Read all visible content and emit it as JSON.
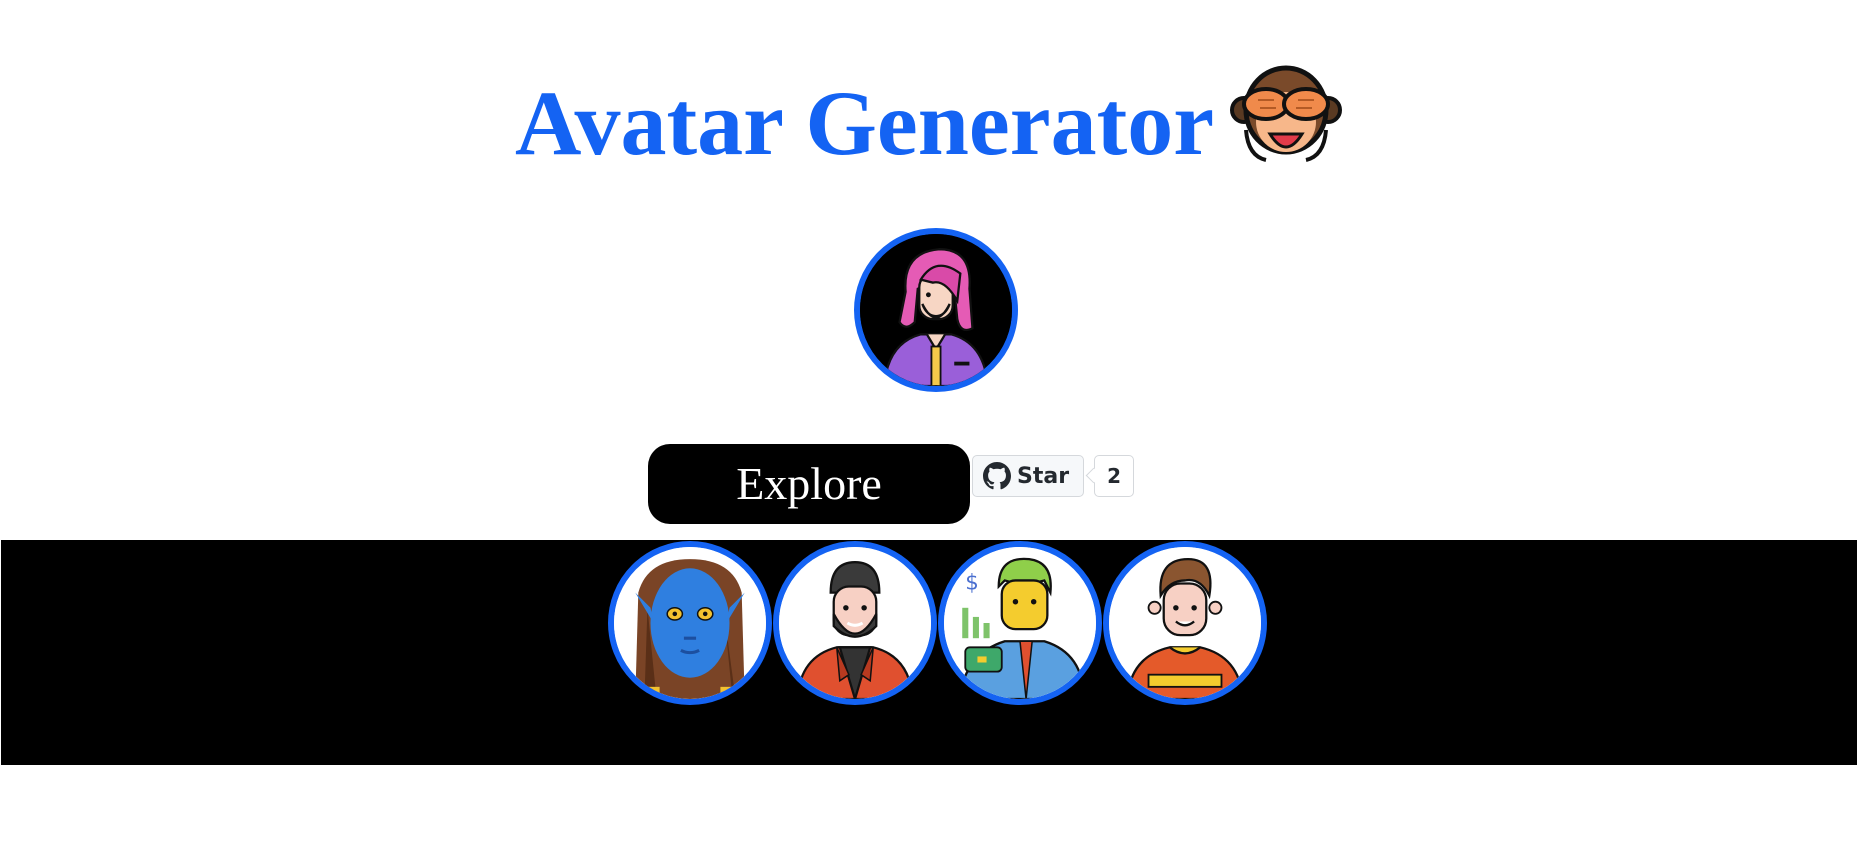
{
  "header": {
    "title": "Avatar Generator",
    "emoji_icon": "see-no-evil-monkey-icon"
  },
  "hero": {
    "avatar_icon": "pink-haired-man-avatar-icon"
  },
  "actions": {
    "explore_label": "Explore",
    "star_label": "Star",
    "star_count": "2",
    "github_icon": "github-icon"
  },
  "gallery": {
    "avatars": [
      {
        "icon": "blue-navi-avatar-icon"
      },
      {
        "icon": "bearded-man-red-jacket-avatar-icon"
      },
      {
        "icon": "businessman-blue-shirt-avatar-icon"
      },
      {
        "icon": "man-orange-shirt-avatar-icon"
      }
    ]
  },
  "colors": {
    "accent": "#1463f3",
    "background": "#ffffff",
    "band": "#000000"
  }
}
